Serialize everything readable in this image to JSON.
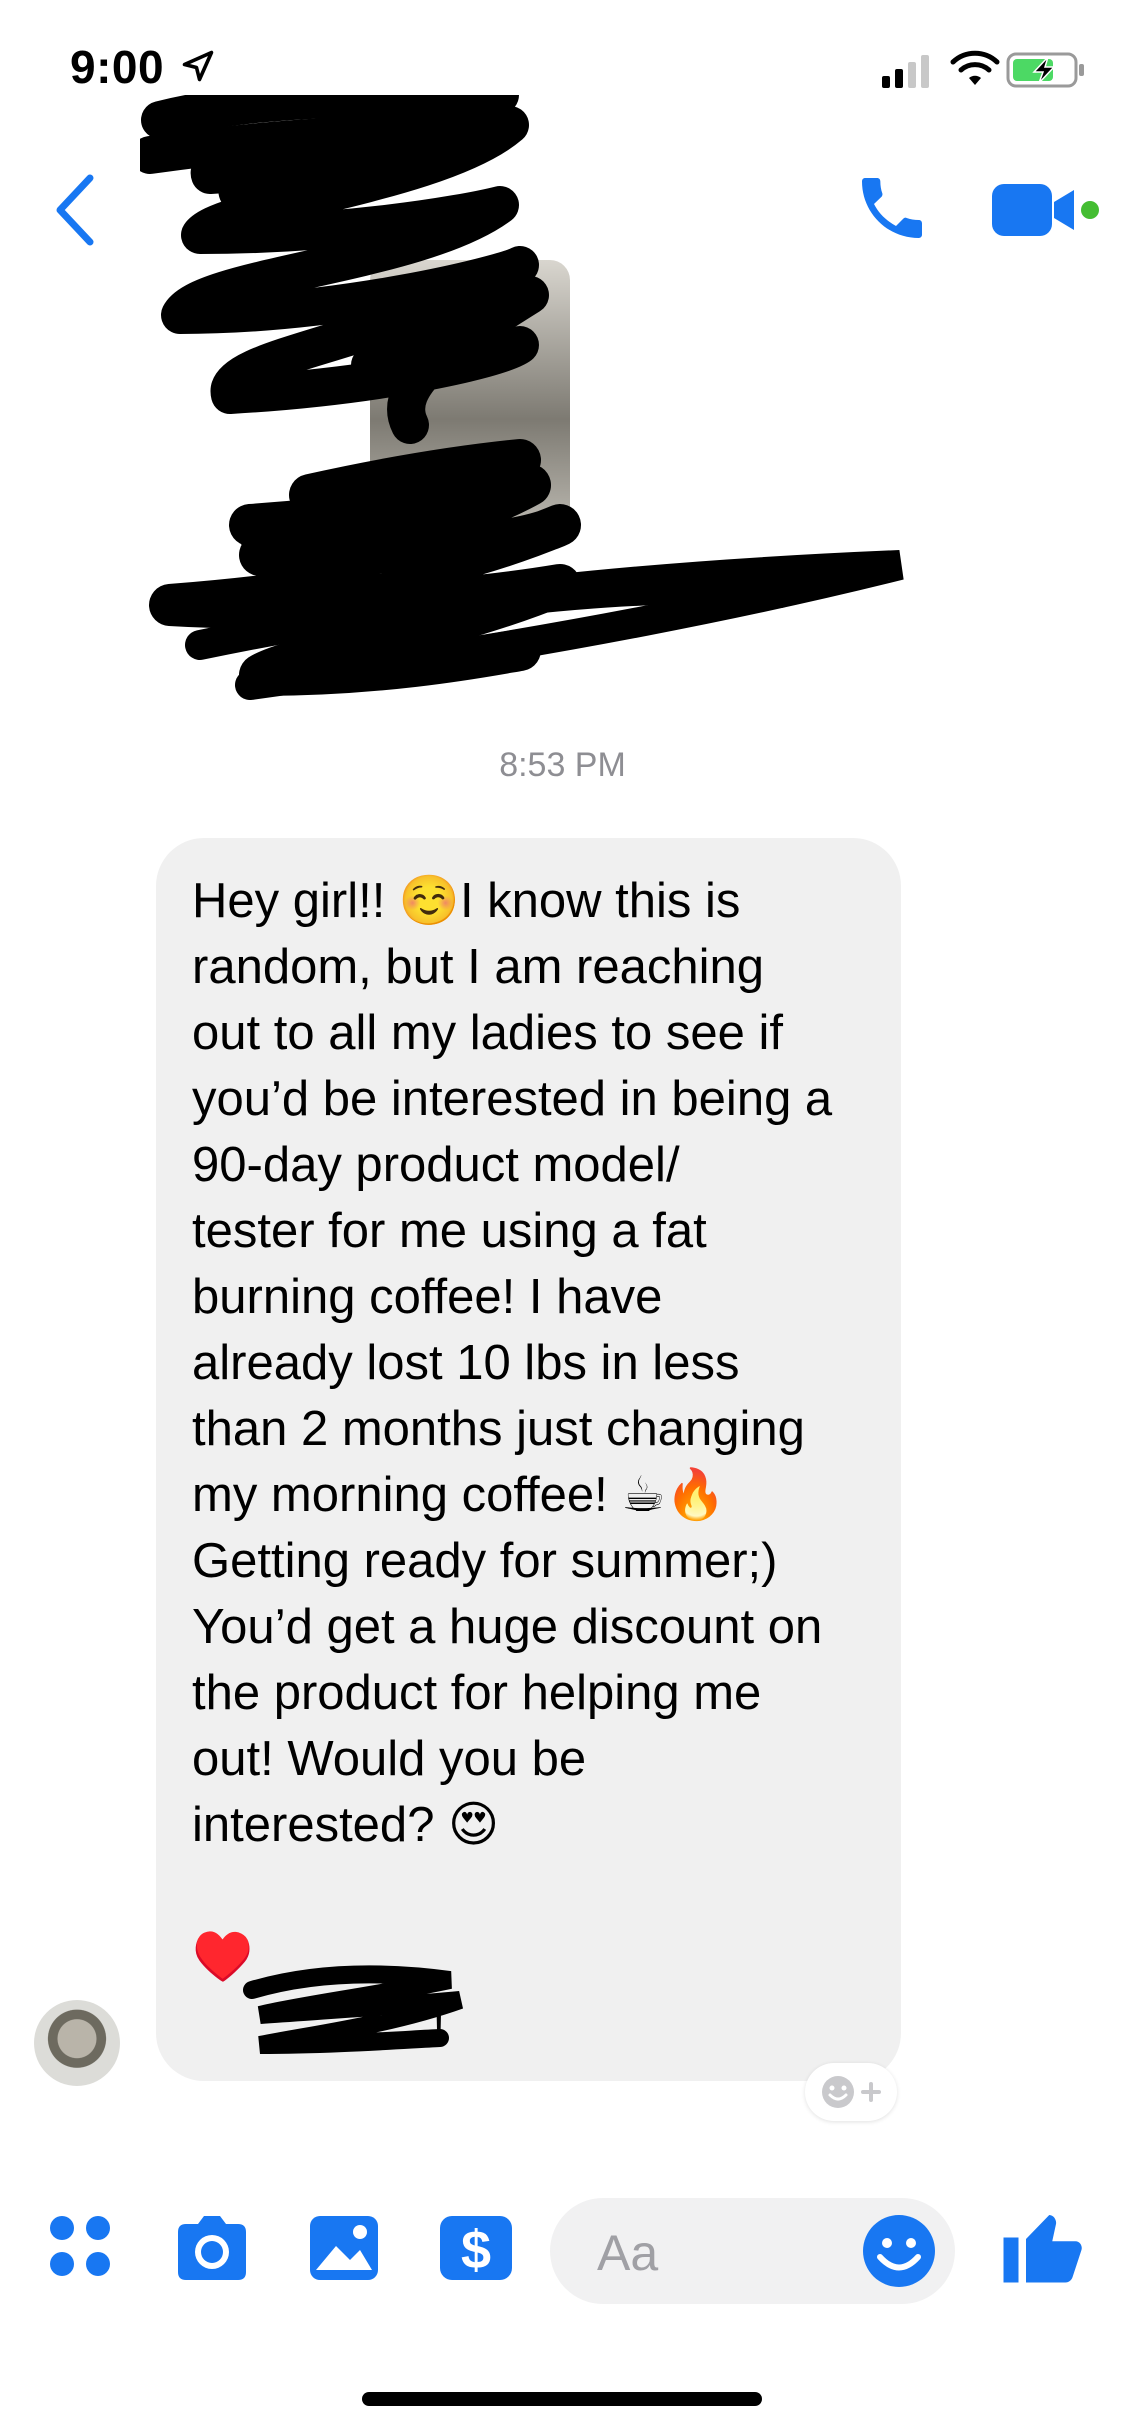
{
  "status_bar": {
    "time": "9:00"
  },
  "conversation": {
    "timestamp": "8:53 PM",
    "message": "Hey girl!! ☺️I know this is\nrandom, but I am reaching\nout to all my ladies to see if\nyou’d be interested in being a\n90-day product model/\ntester for me using a fat\nburning coffee! I have\nalready lost 10 lbs in less\nthan 2 months just changing\nmy morning coffee! ☕🔥\nGetting ready for summer;)\nYou’d get a huge discount on\nthe product for helping me\nout! Would you be\ninterested? 😍\n\n♥️",
    "signoff_tail": "!"
  },
  "composer": {
    "placeholder": "Aa"
  },
  "colors": {
    "accent": "#1877f2",
    "online": "#44bd32",
    "battery": "#4cd964"
  }
}
